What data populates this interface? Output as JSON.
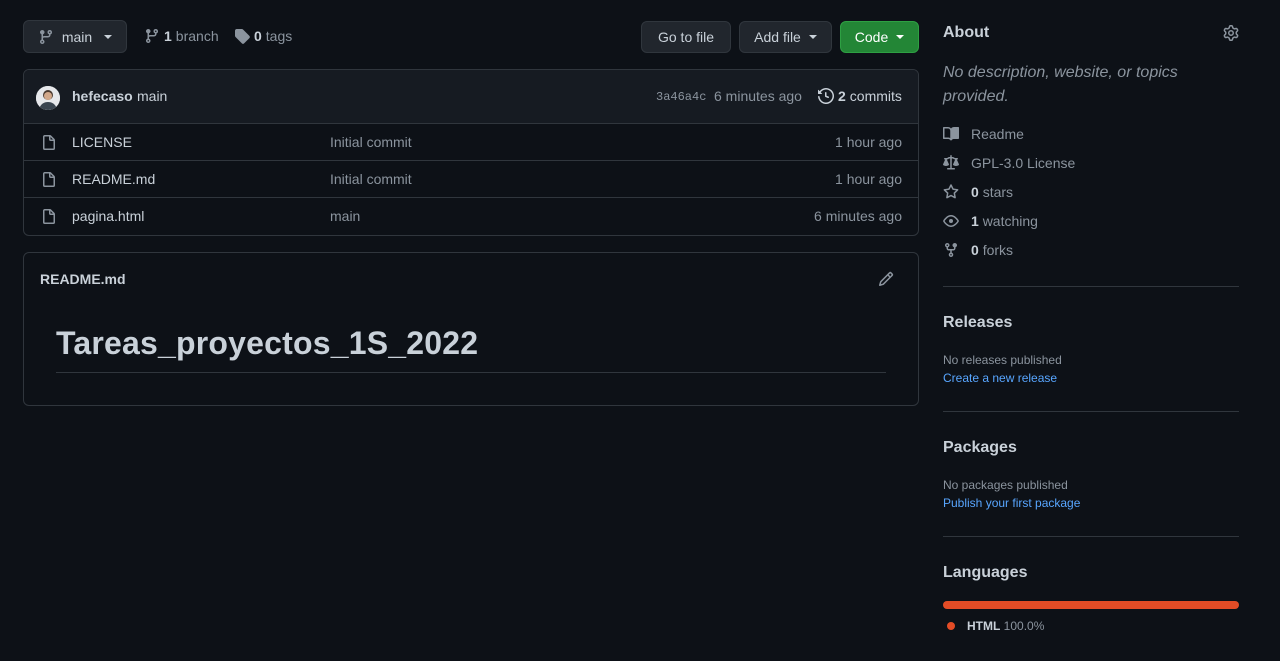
{
  "toolbar": {
    "branch_label": "main",
    "branch_count": "1",
    "branch_word": "branch",
    "tag_count": "0",
    "tag_word": "tags",
    "go_to_file": "Go to file",
    "add_file": "Add file",
    "code": "Code"
  },
  "commit": {
    "author": "hefecaso",
    "message": "main",
    "sha": "3a46a4c",
    "time": "6 minutes ago",
    "commits_count": "2",
    "commits_word": "commits"
  },
  "files": [
    {
      "name": "LICENSE",
      "message": "Initial commit",
      "age": "1 hour ago"
    },
    {
      "name": "README.md",
      "message": "Initial commit",
      "age": "1 hour ago"
    },
    {
      "name": "pagina.html",
      "message": "main",
      "age": "6 minutes ago"
    }
  ],
  "readme": {
    "filename": "README.md",
    "heading": "Tareas_proyectos_1S_2022"
  },
  "about": {
    "title": "About",
    "description": "No description, website, or topics provided.",
    "readme": "Readme",
    "license": "GPL-3.0 License",
    "stars_count": "0",
    "stars_word": "stars",
    "watching_count": "1",
    "watching_word": "watching",
    "forks_count": "0",
    "forks_word": "forks"
  },
  "releases": {
    "title": "Releases",
    "empty": "No releases published",
    "link": "Create a new release"
  },
  "packages": {
    "title": "Packages",
    "empty": "No packages published",
    "link": "Publish your first package"
  },
  "languages": {
    "title": "Languages",
    "items": [
      {
        "name": "HTML",
        "percent": "100.0%",
        "fraction": 1.0,
        "color": "#e34c26"
      }
    ]
  },
  "colors": {
    "background": "#0d1117",
    "accent_green": "#238636",
    "link": "#58a6ff"
  }
}
